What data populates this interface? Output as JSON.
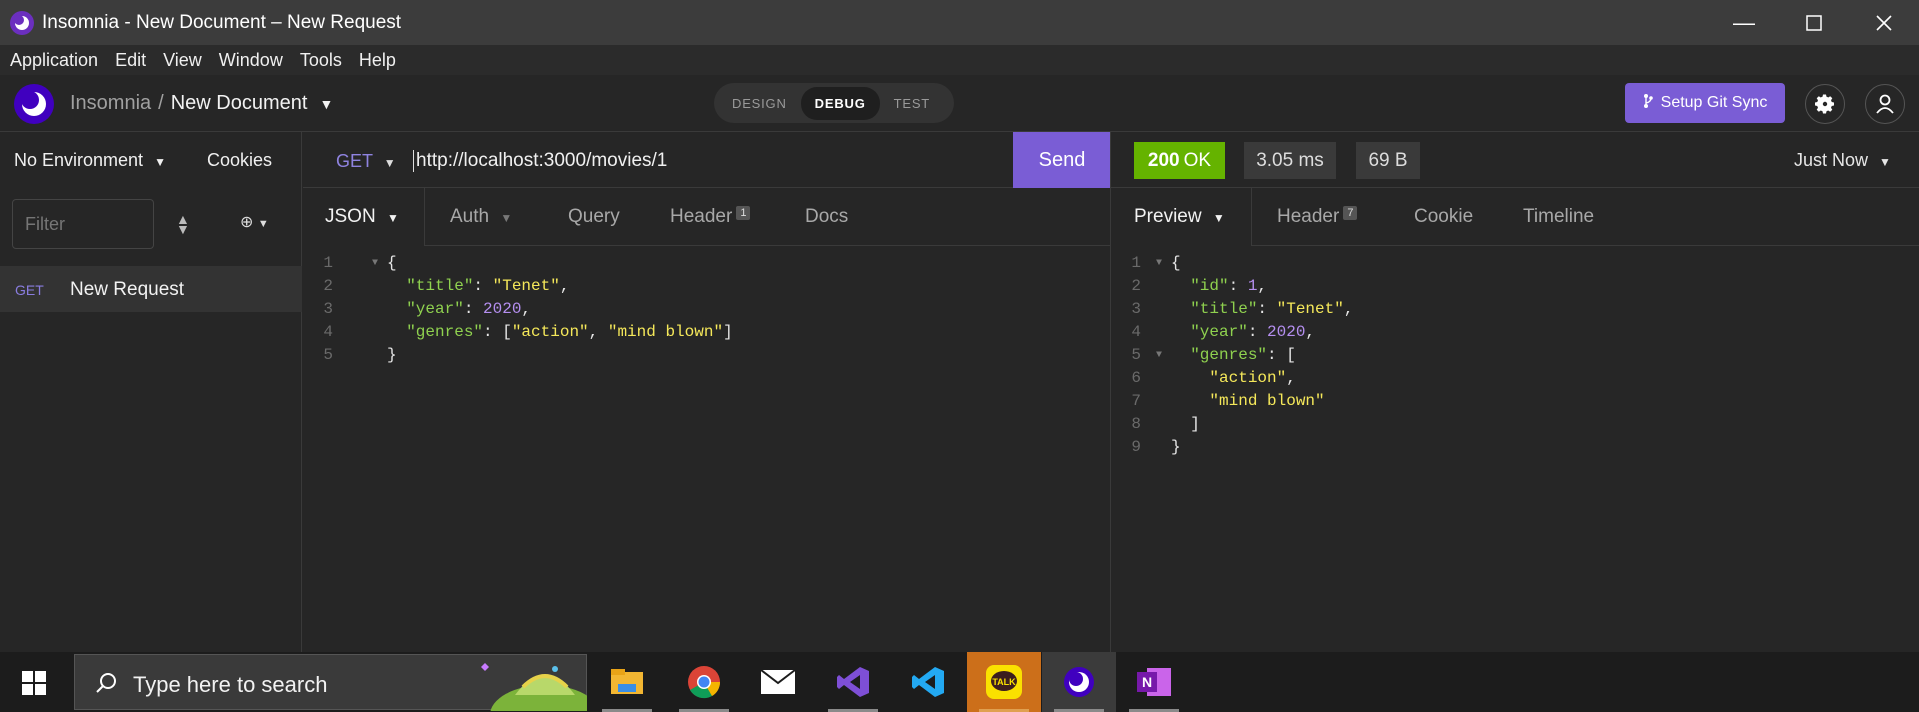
{
  "window": {
    "title": "Insomnia - New Document – New Request"
  },
  "menu": [
    "Application",
    "Edit",
    "View",
    "Window",
    "Tools",
    "Help"
  ],
  "header": {
    "workspace": "Insomnia",
    "separator": "/",
    "document": "New Document",
    "modes": [
      "DESIGN",
      "DEBUG",
      "TEST"
    ],
    "active_mode": "DEBUG",
    "git_sync": "Setup Git Sync"
  },
  "sidebar": {
    "environment": "No Environment",
    "cookies": "Cookies",
    "filter_placeholder": "Filter",
    "requests": [
      {
        "method": "GET",
        "name": "New Request"
      }
    ]
  },
  "request": {
    "method": "GET",
    "url": "http://localhost:3000/movies/1",
    "send_label": "Send",
    "tabs": {
      "body": "JSON",
      "auth": "Auth",
      "query": "Query",
      "header": "Header",
      "header_count": "1",
      "docs": "Docs"
    },
    "body_lines": [
      "1",
      "2",
      "3",
      "4",
      "5"
    ]
  },
  "response": {
    "status_code": "200",
    "status_text": "OK",
    "time": "3.05 ms",
    "size": "69 B",
    "history": "Just Now",
    "tabs": {
      "preview": "Preview",
      "header": "Header",
      "header_count": "7",
      "cookie": "Cookie",
      "timeline": "Timeline"
    },
    "body_lines": [
      "1",
      "2",
      "3",
      "4",
      "5",
      "6",
      "7",
      "8",
      "9"
    ]
  },
  "taskbar": {
    "search_placeholder": "Type here to search",
    "apps": [
      "file-explorer",
      "chrome",
      "mail",
      "visual-studio",
      "vscode",
      "kakaotalk",
      "insomnia",
      "onenote"
    ]
  },
  "colors": {
    "accent": "#7a5dd5",
    "status_ok": "#65b300",
    "json_key": "#8fd14f",
    "json_string": "#f5e85a",
    "json_number": "#b58ff0"
  }
}
